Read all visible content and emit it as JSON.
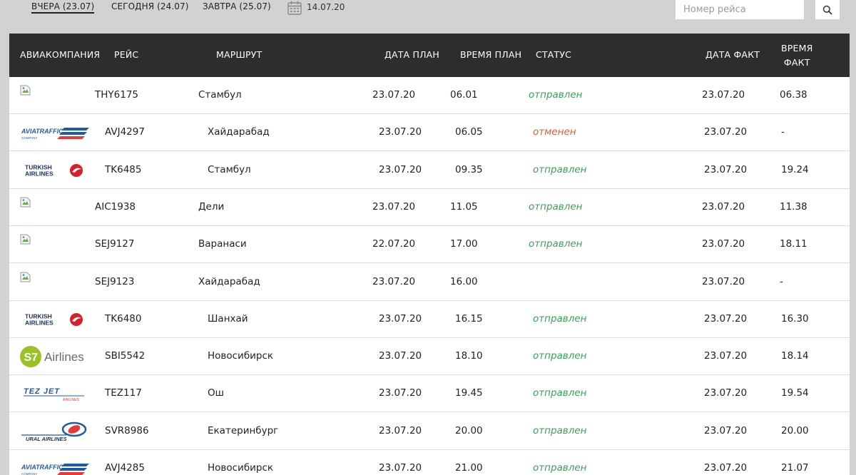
{
  "tabs": [
    {
      "label": "ВЧЕРА (23.07)"
    },
    {
      "label": "СЕГОДНЯ (24.07)"
    },
    {
      "label": "ЗАВТРА (25.07)"
    }
  ],
  "date_picker": {
    "value": "14.07.20"
  },
  "search": {
    "placeholder": "Номер рейса"
  },
  "columns": {
    "airline": "АВИАКОМПАНИЯ",
    "flight": "РЕЙС",
    "route": "МАРШРУТ",
    "date_plan": "ДАТА ПЛАН",
    "time_plan": "ВРЕМЯ ПЛАН",
    "status": "СТАТУС",
    "date_fact": "ДАТА ФАКТ",
    "time_fact_1": "ВРЕМЯ",
    "time_fact_2": "ФАКТ"
  },
  "rows": [
    {
      "logo": "broken-image",
      "flight": "THY6175",
      "route": "Стамбул",
      "date_plan": "23.07.20",
      "time_plan": "06.01",
      "status": "отправлен",
      "status_type": "ok",
      "date_fact": "23.07.20",
      "time_fact": "06.38"
    },
    {
      "logo": "aviatraffic",
      "flight": "AVJ4297",
      "route": "Хайдарабад",
      "date_plan": "23.07.20",
      "time_plan": "06.05",
      "status": "отменен",
      "status_type": "cancel",
      "date_fact": "23.07.20",
      "time_fact": "-"
    },
    {
      "logo": "turkish",
      "flight": "TK6485",
      "route": "Стамбул",
      "date_plan": "23.07.20",
      "time_plan": "09.35",
      "status": "отправлен",
      "status_type": "ok",
      "date_fact": "23.07.20",
      "time_fact": "19.24"
    },
    {
      "logo": "broken-image",
      "flight": "AIC1938",
      "route": "Дели",
      "date_plan": "23.07.20",
      "time_plan": "11.05",
      "status": "отправлен",
      "status_type": "ok",
      "date_fact": "23.07.20",
      "time_fact": "11.38"
    },
    {
      "logo": "broken-image",
      "flight": "SEJ9127",
      "route": "Варанаси",
      "date_plan": "22.07.20",
      "time_plan": "17.00",
      "status": "отправлен",
      "status_type": "ok",
      "date_fact": "23.07.20",
      "time_fact": "18.11"
    },
    {
      "logo": "broken-image",
      "flight": "SEJ9123",
      "route": "Хайдарабад",
      "date_plan": "23.07.20",
      "time_plan": "16.00",
      "status": "",
      "status_type": "ok",
      "date_fact": "23.07.20",
      "time_fact": "-"
    },
    {
      "logo": "turkish",
      "flight": "TK6480",
      "route": "Шанхай",
      "date_plan": "23.07.20",
      "time_plan": "16.15",
      "status": "отправлен",
      "status_type": "ok",
      "date_fact": "23.07.20",
      "time_fact": "16.30"
    },
    {
      "logo": "s7",
      "flight": "SBI5542",
      "route": "Новосибирск",
      "date_plan": "23.07.20",
      "time_plan": "18.10",
      "status": "отправлен",
      "status_type": "ok",
      "date_fact": "23.07.20",
      "time_fact": "18.14"
    },
    {
      "logo": "tezjet",
      "flight": "TEZ117",
      "route": "Ош",
      "date_plan": "23.07.20",
      "time_plan": "19.45",
      "status": "отправлен",
      "status_type": "ok",
      "date_fact": "23.07.20",
      "time_fact": "19.54"
    },
    {
      "logo": "ural",
      "flight": "SVR8986",
      "route": "Екатеринбург",
      "date_plan": "23.07.20",
      "time_plan": "20.00",
      "status": "отправлен",
      "status_type": "ok",
      "date_fact": "23.07.20",
      "time_fact": "20.00"
    },
    {
      "logo": "aviatraffic",
      "flight": "AVJ4285",
      "route": "Новосибирск",
      "date_plan": "23.07.20",
      "time_plan": "21.00",
      "status": "отправлен",
      "status_type": "ok",
      "date_fact": "23.07.20",
      "time_fact": "21.07"
    }
  ],
  "logos": {
    "aviatraffic": {
      "main": "AVIATRAFFIC",
      "sub": "COMPANY"
    },
    "turkish": {
      "line1": "TURKISH",
      "line2": "AIRLINES"
    },
    "s7": {
      "mark": "S7",
      "text": "Airlines"
    },
    "tezjet": {
      "main": "TEZ JET",
      "sub": "AIRLINES"
    },
    "ural": {
      "main": "URAL AIRLINES"
    }
  },
  "colors": {
    "header_bg": "#2d2d2d",
    "page_bg": "#d2d2d2",
    "status_ok": "#3aa05a",
    "status_cancel": "#e05a3a",
    "turkish_red": "#d81e2a",
    "turkish_navy": "#1d3366",
    "s7_green": "#9bc126",
    "blue_accent": "#1f5aa6"
  }
}
